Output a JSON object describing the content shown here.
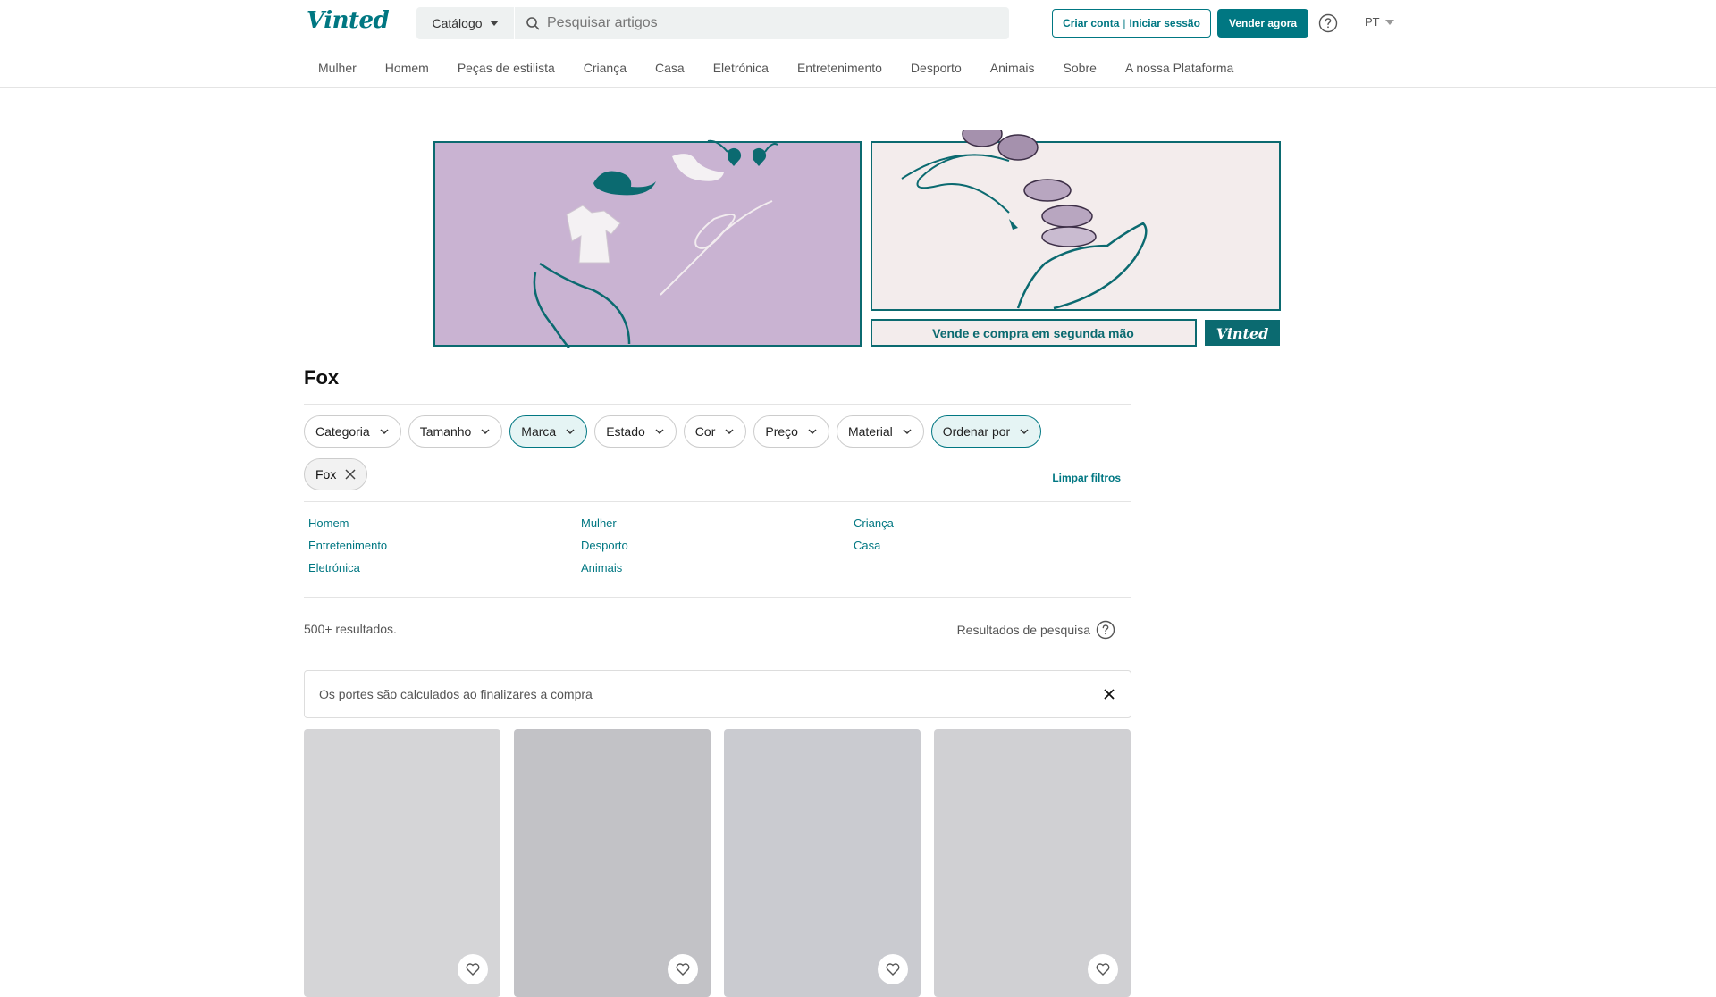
{
  "header": {
    "logo": "Vinted",
    "catalog_label": "Catálogo",
    "search_placeholder": "Pesquisar artigos",
    "signup": "Criar conta",
    "signup_sep": "|",
    "login": "Iniciar sessão",
    "sell": "Vender agora",
    "language": "PT"
  },
  "nav": [
    "Mulher",
    "Homem",
    "Peças de estilista",
    "Criança",
    "Casa",
    "Eletrónica",
    "Entretenimento",
    "Desporto",
    "Animais",
    "Sobre",
    "A nossa Plataforma"
  ],
  "banner": {
    "tagline": "Vende e compra em segunda mão",
    "logo": "Vinted",
    "colors": {
      "lilac": "#c9b3d2",
      "cream": "#f3ecec",
      "teal": "#0b6a70"
    }
  },
  "page": {
    "title": "Fox",
    "filters": [
      {
        "label": "Categoria",
        "active": false
      },
      {
        "label": "Tamanho",
        "active": false
      },
      {
        "label": "Marca",
        "active": true
      },
      {
        "label": "Estado",
        "active": false
      },
      {
        "label": "Cor",
        "active": false
      },
      {
        "label": "Preço",
        "active": false
      },
      {
        "label": "Material",
        "active": false
      },
      {
        "label": "Ordenar por",
        "active": true
      }
    ],
    "active_tag": "Fox",
    "clear_filters": "Limpar filtros",
    "categories": [
      "Homem",
      "Mulher",
      "Criança",
      "Entretenimento",
      "Desporto",
      "Casa",
      "Eletrónica",
      "Animais"
    ],
    "results_count": "500+ resultados.",
    "search_results_label": "Resultados de pesquisa",
    "notice": "Os portes são calculados ao finalizares a compra"
  },
  "products": [
    {
      "color": "#d5d5d7"
    },
    {
      "color": "#c2c2c6"
    },
    {
      "color": "#cacbd0"
    },
    {
      "color": "#d0d0d3"
    }
  ],
  "accent": "#007782"
}
